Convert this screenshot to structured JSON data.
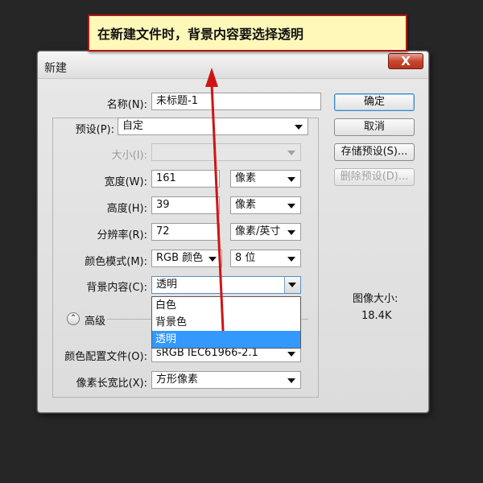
{
  "annotation": {
    "text": "在新建文件时，背景内容要选择透明"
  },
  "dialog": {
    "title": "新建",
    "close_label": "X",
    "name": {
      "label": "名称(N):",
      "value": "未标题-1"
    },
    "preset": {
      "label": "预设(P):",
      "value": "自定"
    },
    "size": {
      "label": "大小(I):",
      "value": ""
    },
    "width": {
      "label": "宽度(W):",
      "value": "161",
      "unit": "像素"
    },
    "height": {
      "label": "高度(H):",
      "value": "39",
      "unit": "像素"
    },
    "resolution": {
      "label": "分辨率(R):",
      "value": "72",
      "unit": "像素/英寸"
    },
    "color_mode": {
      "label": "颜色模式(M):",
      "value": "RGB 颜色",
      "depth": "8 位"
    },
    "background": {
      "label": "背景内容(C):",
      "value": "透明",
      "options": [
        "白色",
        "背景色",
        "透明"
      ],
      "selected_index": 2
    },
    "advanced_label": "高级",
    "color_profile": {
      "label": "颜色配置文件(O):",
      "value": "sRGB IEC61966-2.1"
    },
    "pixel_aspect": {
      "label": "像素长宽比(X):",
      "value": "方形像素"
    },
    "buttons": {
      "ok": "确定",
      "cancel": "取消",
      "save_preset": "存储预设(S)...",
      "delete_preset": "删除预设(D)..."
    },
    "image_size": {
      "label": "图像大小:",
      "value": "18.4K"
    }
  },
  "colors": {
    "annotation_bg": "#fff8b8",
    "annotation_border": "#b01818",
    "arrow": "#d01414",
    "selection": "#3399ff"
  }
}
